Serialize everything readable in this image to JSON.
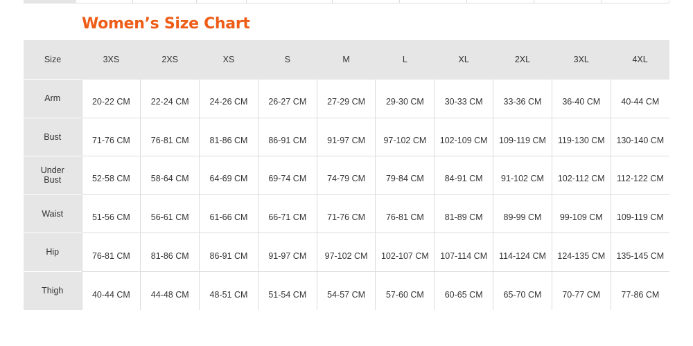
{
  "title": "Women’s Size Chart",
  "table": {
    "header_label": "Size",
    "sizes": [
      "3XS",
      "2XS",
      "XS",
      "S",
      "M",
      "L",
      "XL",
      "2XL",
      "3XL",
      "4XL"
    ],
    "rows": [
      {
        "label": "Arm",
        "values": [
          "20-22 CM",
          "22-24 CM",
          "24-26 CM",
          "26-27 CM",
          "27-29 CM",
          "29-30 CM",
          "30-33 CM",
          "33-36 CM",
          "36-40 CM",
          "40-44 CM"
        ]
      },
      {
        "label": "Bust",
        "values": [
          "71-76 CM",
          "76-81 CM",
          "81-86 CM",
          "86-91 CM",
          "91-97 CM",
          "97-102 CM",
          "102-109 CM",
          "109-119 CM",
          "119-130 CM",
          "130-140 CM"
        ]
      },
      {
        "label": "Under Bust",
        "values": [
          "52-58 CM",
          "58-64 CM",
          "64-69 CM",
          "69-74 CM",
          "74-79 CM",
          "79-84 CM",
          "84-91 CM",
          "91-102 CM",
          "102-112 CM",
          "112-122 CM"
        ]
      },
      {
        "label": "Waist",
        "values": [
          "51-56 CM",
          "56-61 CM",
          "61-66 CM",
          "66-71 CM",
          "71-76 CM",
          "76-81 CM",
          "81-89 CM",
          "89-99 CM",
          "99-109 CM",
          "109-119 CM"
        ]
      },
      {
        "label": "Hip",
        "values": [
          "76-81 CM",
          "81-86 CM",
          "86-91 CM",
          "91-97 CM",
          "97-102 CM",
          "102-107 CM",
          "107-114 CM",
          "114-124 CM",
          "124-135 CM",
          "135-145 CM"
        ]
      },
      {
        "label": "Thigh",
        "values": [
          "40-44 CM",
          "44-48 CM",
          "48-51 CM",
          "51-54 CM",
          "54-57 CM",
          "57-60 CM",
          "60-65 CM",
          "65-70 CM",
          "70-77 CM",
          "77-86 CM"
        ]
      }
    ]
  },
  "colors": {
    "title_accent": "#ee5d17",
    "header_background": "#e6e6e6",
    "grid_line": "#dcdcdc",
    "text": "#333333"
  }
}
